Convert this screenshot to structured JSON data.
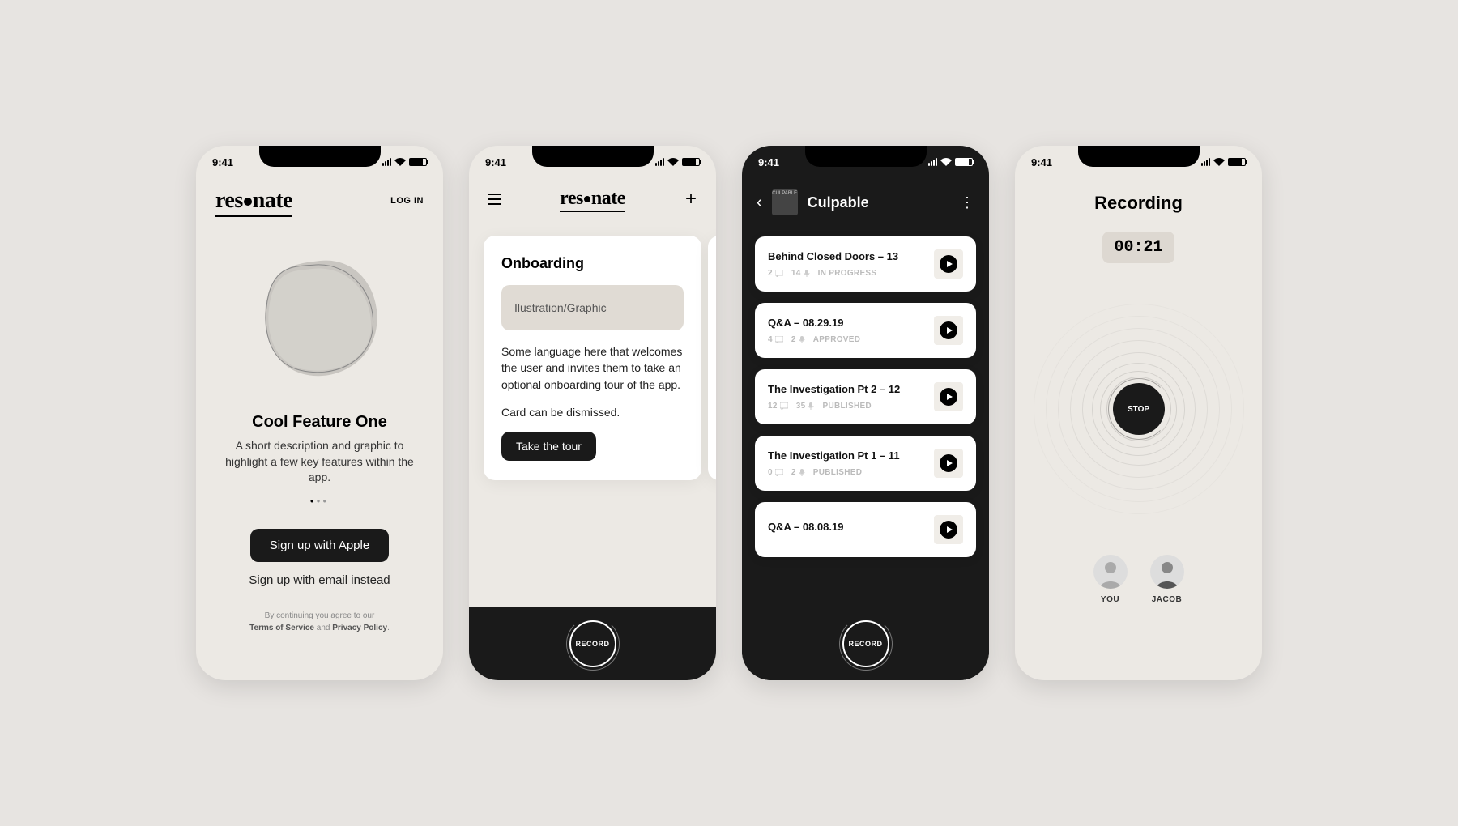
{
  "status_time": "9:41",
  "brand": "resonate",
  "phone1": {
    "login": "LOG IN",
    "title": "Cool Feature One",
    "desc": "A short description and graphic to highlight a few key features within the app.",
    "signup_apple": "Sign up with Apple",
    "signup_email": "Sign up with email instead",
    "legal_pre": "By continuing you agree to our",
    "legal_tos": "Terms of Service",
    "legal_and": " and ",
    "legal_pp": "Privacy Policy"
  },
  "phone2": {
    "card_title": "Onboarding",
    "placeholder": "Ilustration/Graphic",
    "body1": "Some language here that welcomes the user and invites them to take an optional onboarding tour of the app.",
    "body2": "Card can be dismissed.",
    "cta": "Take the tour",
    "record": "RECORD"
  },
  "phone3": {
    "show_thumb_label": "CULPABLE",
    "show": "Culpable",
    "record": "RECORD",
    "episodes": [
      {
        "title": "Behind Closed Doors – 13",
        "comments": "2",
        "mics": "14",
        "status": "IN PROGRESS"
      },
      {
        "title": "Q&A – 08.29.19",
        "comments": "4",
        "mics": "2",
        "status": "APPROVED"
      },
      {
        "title": "The Investigation Pt 2  – 12",
        "comments": "12",
        "mics": "35",
        "status": "PUBLISHED"
      },
      {
        "title": "The Investigation Pt 1  – 11",
        "comments": "0",
        "mics": "2",
        "status": "PUBLISHED"
      },
      {
        "title": "Q&A – 08.08.19",
        "comments": "",
        "mics": "",
        "status": ""
      }
    ]
  },
  "phone4": {
    "title": "Recording",
    "timer": "00:21",
    "stop": "STOP",
    "participants": [
      {
        "name": "YOU"
      },
      {
        "name": "JACOB"
      }
    ]
  }
}
